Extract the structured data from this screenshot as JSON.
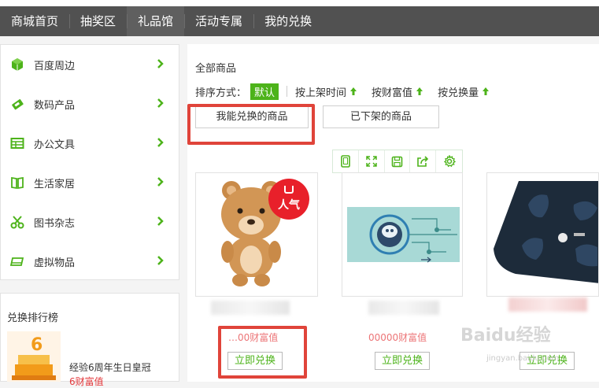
{
  "nav": {
    "items": [
      "商城首页",
      "抽奖区",
      "礼品馆",
      "活动专属",
      "我的兑换"
    ],
    "active_index": 2
  },
  "sidebar": {
    "items": [
      {
        "label": "百度周边",
        "icon": "cube-icon"
      },
      {
        "label": "数码产品",
        "icon": "phone-icon"
      },
      {
        "label": "办公文具",
        "icon": "table-icon"
      },
      {
        "label": "生活家居",
        "icon": "book-icon"
      },
      {
        "label": "图书杂志",
        "icon": "scissors-icon"
      },
      {
        "label": "虚拟物品",
        "icon": "card-icon"
      }
    ]
  },
  "ranking": {
    "title": "兑换排行榜",
    "item_name": "经验6周年生日皇冠",
    "item_sub": "6财富值"
  },
  "main": {
    "section_title": "全部商品",
    "sort_label": "排序方式：",
    "sort_default": "默认",
    "sort_options": [
      "按上架时间",
      "按财富值",
      "按兑换量"
    ],
    "filter_mine": "我能兑换的商品",
    "filter_removed": "已下架的商品"
  },
  "products": [
    {
      "badge": "人气",
      "price": "…00财富值",
      "action": "立即兑换"
    },
    {
      "price": "00000财富值",
      "action": "立即兑换"
    },
    {
      "price": "",
      "action": "立即兑换"
    }
  ],
  "watermark": {
    "brand": "Baidu经验",
    "url": "jingyan.baidu.com"
  },
  "colors": {
    "nav_bg": "#515151",
    "accent_green": "#4db31a",
    "highlight_red": "#e0443a",
    "badge_red": "#e8202a"
  }
}
